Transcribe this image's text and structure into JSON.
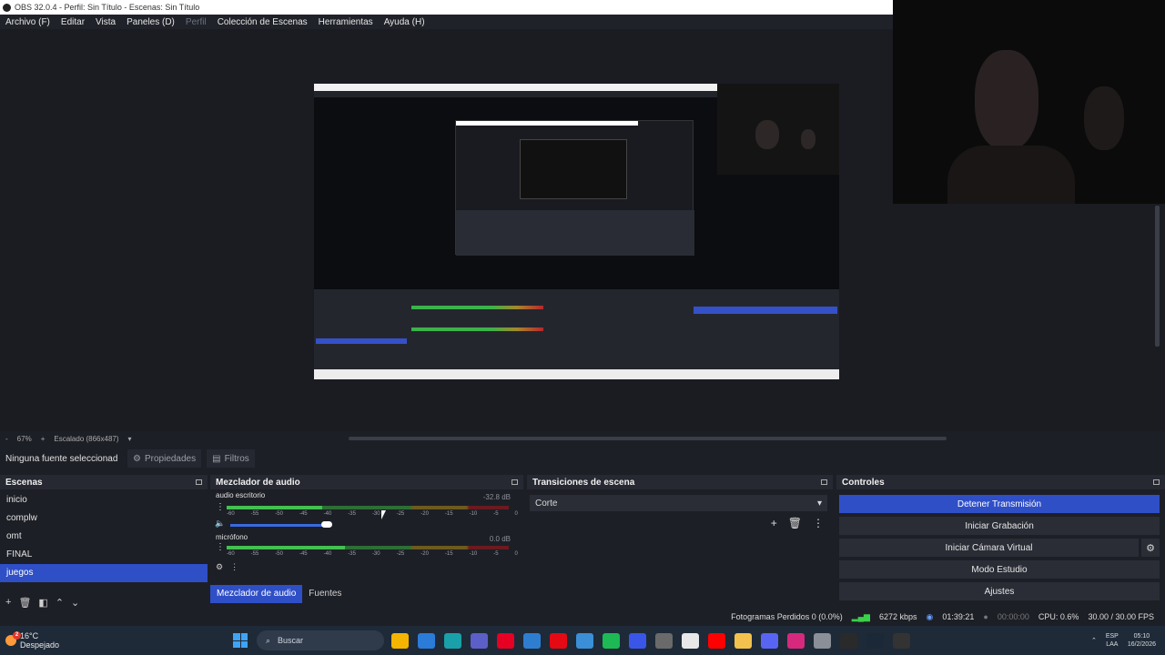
{
  "window": {
    "title": "OBS 32.0.4 - Perfil: Sin Título - Escenas: Sin Título"
  },
  "menu": [
    "Archivo (F)",
    "Editar",
    "Vista",
    "Paneles (D)",
    "Perfil",
    "Colección de Escenas",
    "Herramientas",
    "Ayuda (H)"
  ],
  "zoom": {
    "percent": "67%",
    "plus": "+",
    "minus": "-",
    "scale_label": "Escalado (866x487)"
  },
  "sourcebar": {
    "no_source": "Ninguna fuente seleccionad",
    "properties": "Propiedades",
    "filters": "Filtros"
  },
  "scenes": {
    "title": "Escenas",
    "items": [
      "inicio",
      "complw",
      "omt",
      "FINAL",
      "juegos"
    ],
    "selected": "juegos"
  },
  "mixer": {
    "title": "Mezclador de audio",
    "tracks": [
      {
        "name": "audio escritorio",
        "db": "-32.8 dB",
        "level": 0.34
      },
      {
        "name": "micrófono",
        "db": "0.0 dB",
        "level": 0.42
      }
    ],
    "ticks": [
      "-60",
      "-55",
      "-50",
      "-45",
      "-40",
      "-35",
      "-30",
      "-25",
      "-20",
      "-15",
      "-10",
      "-5",
      "0"
    ],
    "tabs": [
      "Mezclador de audio",
      "Fuentes"
    ]
  },
  "transitions": {
    "title": "Transiciones de escena",
    "selected": "Corte"
  },
  "controls": {
    "title": "Controles",
    "stop_stream": "Detener Transmisión",
    "start_record": "Iniciar Grabación",
    "virtual_cam": "Iniciar Cámara Virtual",
    "studio_mode": "Modo Estudio",
    "settings": "Ajustes"
  },
  "status": {
    "dropped": "Fotogramas Perdidos 0 (0.0%)",
    "bitrate": "6272 kbps",
    "stream_time": "01:39:21",
    "rec_time": "00:00:00",
    "cpu": "CPU: 0.6%",
    "fps": "30.00 / 30.00 FPS"
  },
  "taskbar": {
    "temp": "16°C",
    "weather": "Despejado",
    "search": "Buscar",
    "lang1": "ESP",
    "lang2": "LAA",
    "time": "05:10",
    "date": "16/2/2026",
    "badge": "2"
  },
  "colors": {
    "accent": "#2f4fc7",
    "bg": "#1d1f26"
  }
}
